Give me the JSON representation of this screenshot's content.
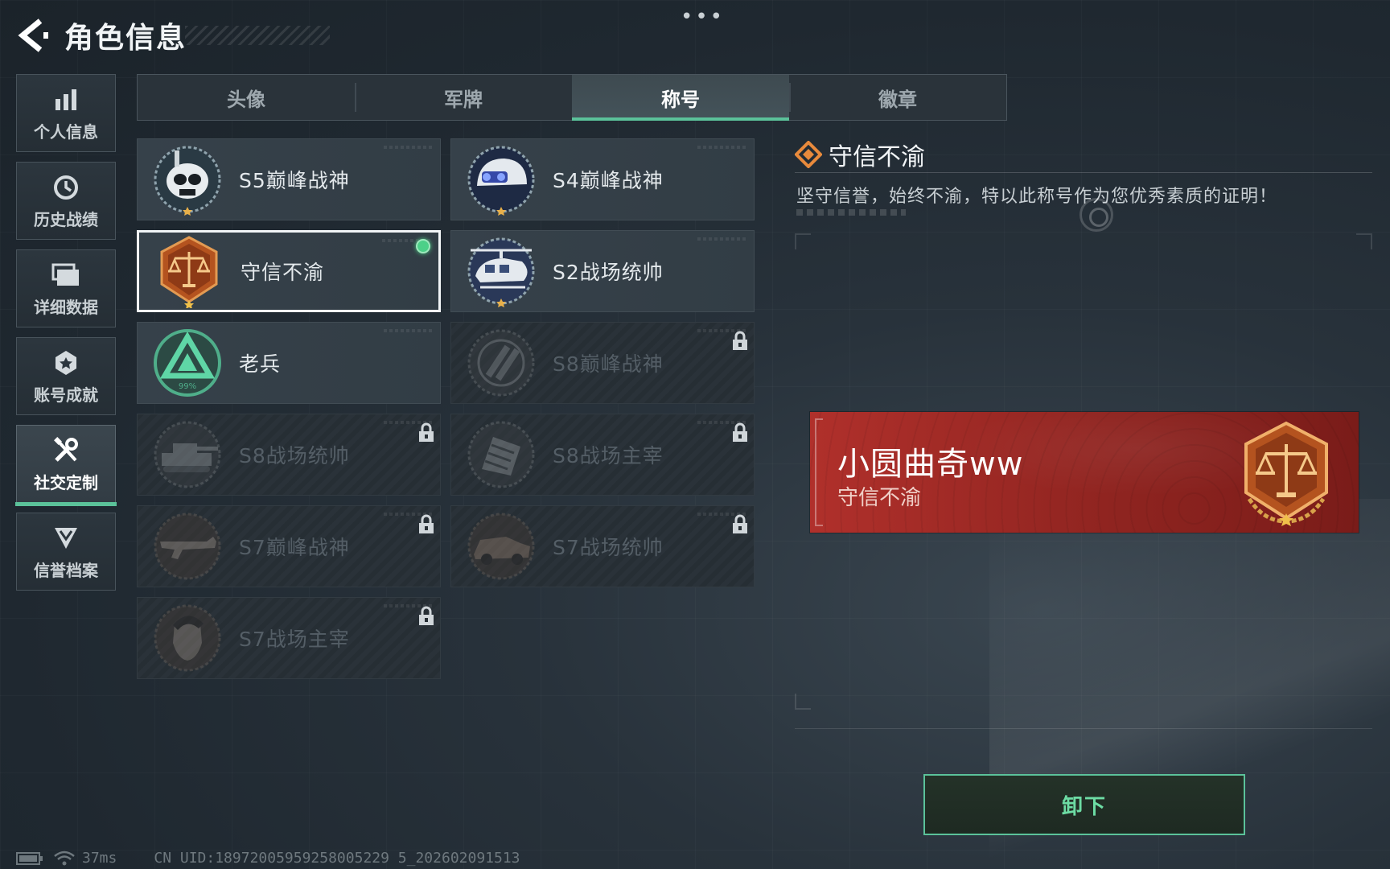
{
  "header": {
    "title": "角色信息",
    "more_label": "•••"
  },
  "sidebar": {
    "items": [
      {
        "label": "个人信息",
        "icon": "bar-chart-icon",
        "active": false
      },
      {
        "label": "历史战绩",
        "icon": "history-clock-icon",
        "active": false
      },
      {
        "label": "详细数据",
        "icon": "folder-icon",
        "active": false
      },
      {
        "label": "账号成就",
        "icon": "achievement-star-icon",
        "active": false
      },
      {
        "label": "社交定制",
        "icon": "tools-icon",
        "active": true
      },
      {
        "label": "信誉档案",
        "icon": "shield-chevron-icon",
        "active": false
      }
    ]
  },
  "tabs": [
    {
      "label": "头像",
      "active": false
    },
    {
      "label": "军牌",
      "active": false
    },
    {
      "label": "称号",
      "active": true
    },
    {
      "label": "徽章",
      "active": false
    }
  ],
  "titles": [
    {
      "name": "S5巅峰战神",
      "emblem": "diver-skull-emblem",
      "locked": false,
      "selected": false,
      "equipped": false
    },
    {
      "name": "S4巅峰战神",
      "emblem": "helmet-nvg-emblem",
      "locked": false,
      "selected": false,
      "equipped": false
    },
    {
      "name": "守信不渝",
      "emblem": "scales-of-justice-emblem",
      "locked": false,
      "selected": true,
      "equipped": true
    },
    {
      "name": "S2战场统帅",
      "emblem": "helicopter-emblem",
      "locked": false,
      "selected": false,
      "equipped": false
    },
    {
      "name": "老兵",
      "emblem": "veteran-triangle-emblem",
      "badge_text": "99%",
      "locked": false,
      "selected": false,
      "equipped": false
    },
    {
      "name": "S8巅峰战神",
      "emblem": "slash-stripes-emblem",
      "locked": true,
      "selected": false,
      "equipped": false
    },
    {
      "name": "S8战场统帅",
      "emblem": "tank-emblem",
      "locked": true,
      "selected": false,
      "equipped": false
    },
    {
      "name": "S8战场主宰",
      "emblem": "building-emblem",
      "locked": true,
      "selected": false,
      "equipped": false
    },
    {
      "name": "S7巅峰战神",
      "emblem": "rifle-emblem",
      "locked": true,
      "selected": false,
      "equipped": false
    },
    {
      "name": "S7战场统帅",
      "emblem": "vehicle-emblem",
      "locked": true,
      "selected": false,
      "equipped": false
    },
    {
      "name": "S7战场主宰",
      "emblem": "soldier-portrait-emblem",
      "locked": true,
      "selected": false,
      "equipped": false
    }
  ],
  "detail": {
    "title": "守信不渝",
    "description": "坚守信誉，始终不渝，特以此称号作为您优秀素质的证明！"
  },
  "preview": {
    "player_name": "小圆曲奇ww",
    "title": "守信不渝",
    "emblem": "scales-of-justice-emblem"
  },
  "actions": {
    "unequip_label": "卸下"
  },
  "footer": {
    "ping": "37ms",
    "uid": "CN UID:18972005959258005229 5_202602091513"
  },
  "colors": {
    "accent": "#5bc29a",
    "preview_red": "#a52b27",
    "emblem_bronze": "#c46a2a"
  }
}
